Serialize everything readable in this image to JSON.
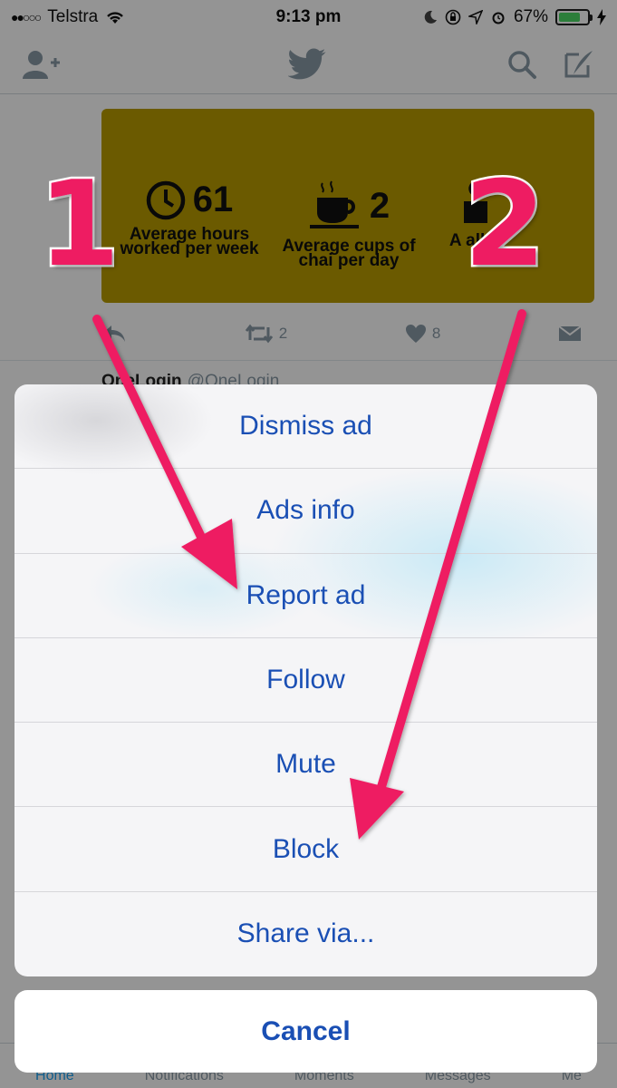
{
  "status_bar": {
    "carrier": "Telstra",
    "time": "9:13 pm",
    "battery": "67%"
  },
  "ad": {
    "stats": [
      {
        "number": "61",
        "label": "Average hours worked per week",
        "icon": "clock-icon"
      },
      {
        "number": "2",
        "label": "Average cups of chai per day",
        "icon": "teacup-icon"
      },
      {
        "number": "",
        "label": "A all p",
        "icon": "partial-icon"
      }
    ],
    "background_color": "#b89c00"
  },
  "tweet_actions": {
    "retweets": "2",
    "likes": "8"
  },
  "next_tweet": {
    "author": "OneLogin",
    "handle": "@OneLogin"
  },
  "tabs": [
    "Home",
    "Notifications",
    "Moments",
    "Messages",
    "Me"
  ],
  "action_sheet": {
    "options": [
      "Dismiss ad",
      "Ads info",
      "Report ad",
      "Follow",
      "Mute",
      "Block",
      "Share via..."
    ],
    "cancel": "Cancel"
  },
  "annotations": {
    "callout_1": "1",
    "callout_2": "2",
    "color": "#ee1c62"
  },
  "colors": {
    "sheet_text": "#1a4fb4",
    "twitter_blue": "#1da1f2"
  }
}
